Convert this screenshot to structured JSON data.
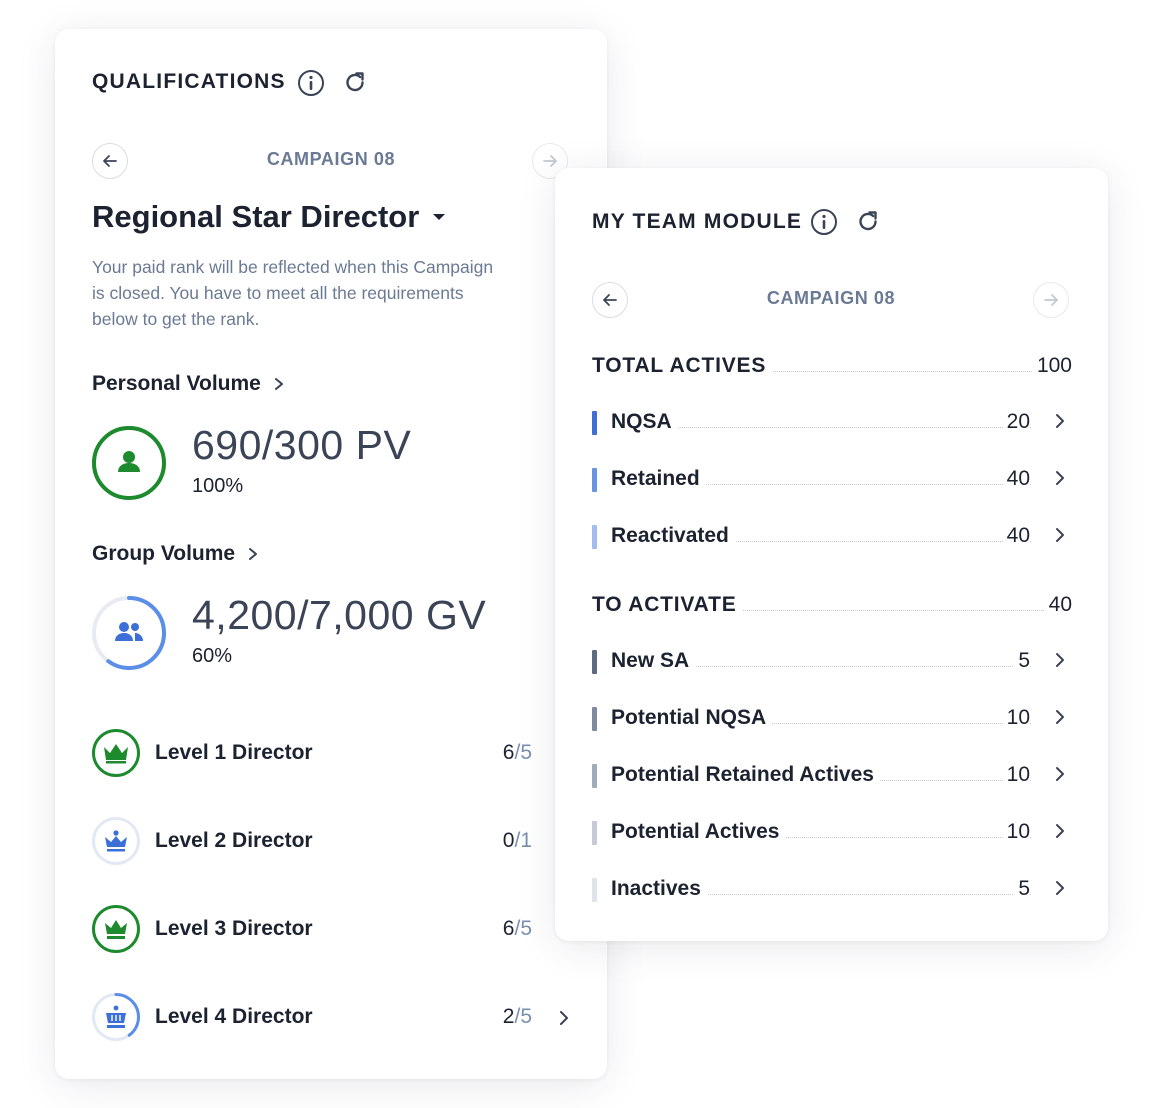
{
  "qualifications": {
    "title": "QUALIFICATIONS",
    "campaign": "CAMPAIGN 08",
    "rank": "Regional Star Director",
    "description": "Your paid rank will be reflected when this Campaign is closed. You have to meet all the requirements below to get the rank.",
    "personal_volume": {
      "label": "Personal Volume",
      "value": "690/300 PV",
      "percent_label": "100%",
      "progress": 1.0,
      "color": "#1e8a2e"
    },
    "group_volume": {
      "label": "Group Volume",
      "value": "4,200/7,000 GV",
      "percent_label": "60%",
      "progress": 0.6,
      "color": "#5b8ee6"
    },
    "levels": [
      {
        "name": "Level 1 Director",
        "current": "6",
        "target": "5",
        "status": "complete",
        "has_chevron": false
      },
      {
        "name": "Level 2 Director",
        "current": "0",
        "target": "1",
        "status": "pending",
        "has_chevron": false
      },
      {
        "name": "Level 3 Director",
        "current": "6",
        "target": "5",
        "status": "complete",
        "has_chevron": false
      },
      {
        "name": "Level 4 Director",
        "current": "2",
        "target": "5",
        "status": "partial",
        "progress": 0.4,
        "has_chevron": true
      }
    ]
  },
  "team": {
    "title": "MY TEAM MODULE",
    "campaign": "CAMPAIGN 08",
    "total_actives": {
      "label": "TOTAL ACTIVES",
      "value": "100"
    },
    "actives_rows": [
      {
        "label": "NQSA",
        "value": "20",
        "color": "#3d6fd8"
      },
      {
        "label": "Retained",
        "value": "40",
        "color": "#6a93e3"
      },
      {
        "label": "Reactivated",
        "value": "40",
        "color": "#a3bcef"
      }
    ],
    "to_activate": {
      "label": "TO ACTIVATE",
      "value": "40"
    },
    "activate_rows": [
      {
        "label": "New SA",
        "value": "5",
        "color": "#5d6a82"
      },
      {
        "label": "Potential NQSA",
        "value": "10",
        "color": "#7f8aa0"
      },
      {
        "label": "Potential Retained Actives",
        "value": "10",
        "color": "#a2abbd"
      },
      {
        "label": "Potential Actives",
        "value": "10",
        "color": "#c4cad6"
      },
      {
        "label": "Inactives",
        "value": "5",
        "color": "#dfe3ea"
      }
    ]
  }
}
